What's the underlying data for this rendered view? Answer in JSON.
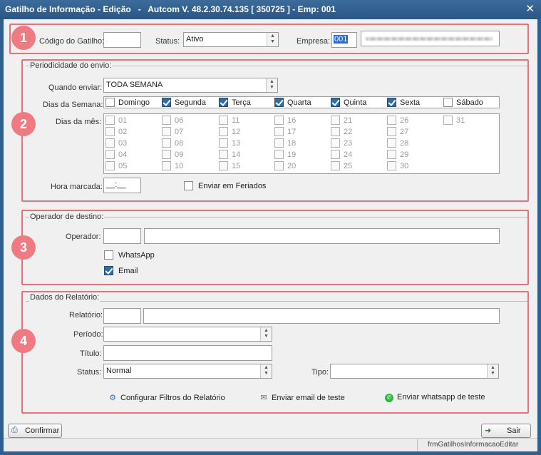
{
  "window": {
    "title": "Gatilho de Informação - Edição   -   Autcom V. 48.2.30.74.135 [ 350725 ] - Emp: 001",
    "close_glyph": "✕"
  },
  "badges": [
    "1",
    "2",
    "3",
    "4"
  ],
  "header": {
    "codigo_label": "Código do Gatilho:",
    "codigo_value": "",
    "status_label": "Status:",
    "status_value": "Ativo",
    "empresa_label": "Empresa:",
    "empresa_value": "001"
  },
  "periodicidade": {
    "title": "Periodicidade do envio:",
    "quando_label": "Quando enviar:",
    "quando_value": "TODA SEMANA",
    "dias_semana_label": "Dias da Semana:",
    "weekdays": [
      {
        "label": "Domingo",
        "checked": false
      },
      {
        "label": "Segunda",
        "checked": true
      },
      {
        "label": "Terça",
        "checked": true
      },
      {
        "label": "Quarta",
        "checked": true
      },
      {
        "label": "Quinta",
        "checked": true
      },
      {
        "label": "Sexta",
        "checked": true
      },
      {
        "label": "Sábado",
        "checked": false
      }
    ],
    "dias_mes_label": "Dias da mês:",
    "month_days": [
      "01",
      "02",
      "03",
      "04",
      "05",
      "06",
      "07",
      "08",
      "09",
      "10",
      "11",
      "12",
      "13",
      "14",
      "15",
      "16",
      "17",
      "18",
      "19",
      "20",
      "21",
      "22",
      "23",
      "24",
      "25",
      "26",
      "27",
      "28",
      "29",
      "30",
      "31"
    ],
    "hora_label": "Hora marcada:",
    "hora_value": "__:__",
    "feriados_label": "Enviar em Feriados",
    "feriados_checked": false
  },
  "operador": {
    "title": "Operador de destino:",
    "operador_label": "Operador:",
    "operador_code": "",
    "operador_name": "",
    "whatsapp_label": "WhatsApp",
    "whatsapp_checked": false,
    "email_label": "Email",
    "email_checked": true
  },
  "relatorio": {
    "title": "Dados do Relatório:",
    "relatorio_label": "Relatório:",
    "relatorio_code": "",
    "relatorio_name": "",
    "periodo_label": "Período:",
    "periodo_value": "",
    "titulo_label": "Título:",
    "titulo_value": "",
    "status_label": "Status:",
    "status_value": "Normal",
    "tipo_label": "Tipo:",
    "tipo_value": "",
    "configurar_label": "Configurar Filtros do Relatório",
    "email_teste_label": "Enviar email de teste",
    "whatsapp_teste_label": "Enviar whatsapp de teste"
  },
  "footer": {
    "confirmar_label": "Confirmar",
    "sair_label": "Sair",
    "form_name": "frmGatilhosInformacaoEditar"
  },
  "colors": {
    "title_bar": "#2a5683",
    "highlight_box": "#e8727c",
    "checkbox_checked": "#2e6ea6"
  }
}
